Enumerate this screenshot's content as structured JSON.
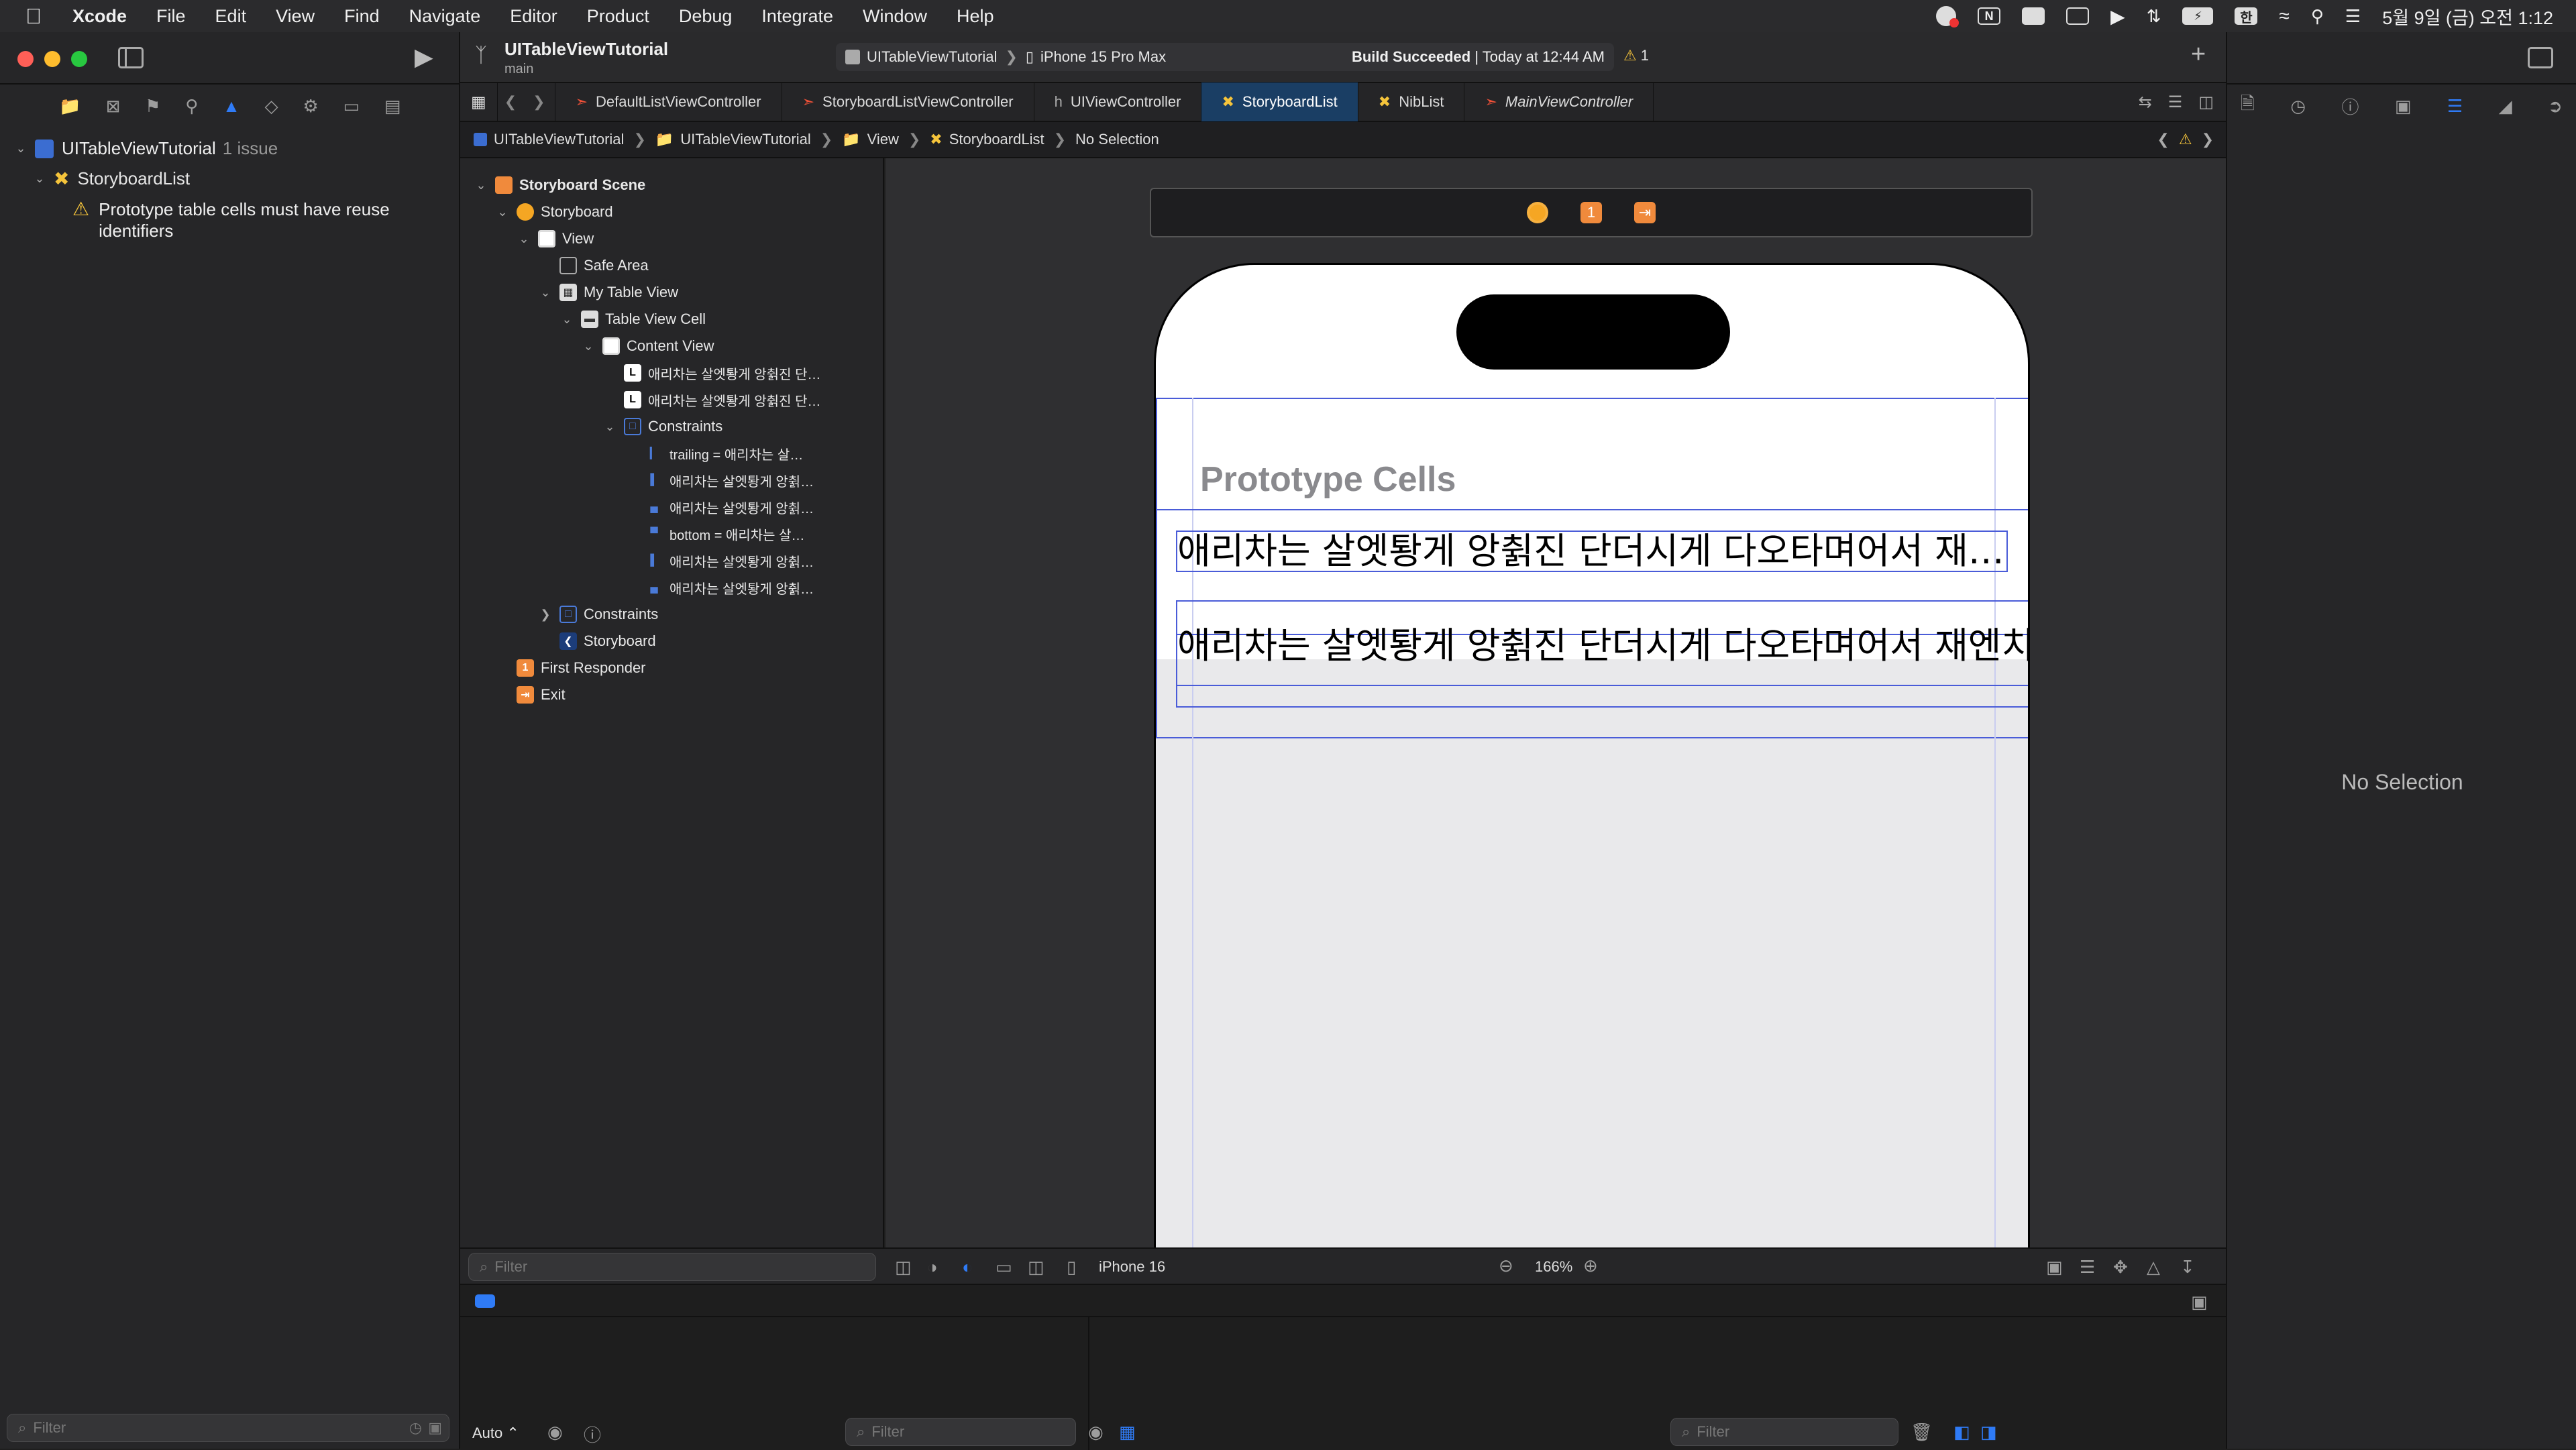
{
  "menubar": {
    "items": [
      "Xcode",
      "File",
      "Edit",
      "View",
      "Find",
      "Navigate",
      "Editor",
      "Product",
      "Debug",
      "Integrate",
      "Window",
      "Help"
    ],
    "ime": "한",
    "notion_badge": "N",
    "datetime": "5월 9일 (금) 오전 1:12"
  },
  "navigator": {
    "project_name": "UITableViewTutorial",
    "issue_count": "1 issue",
    "file_name": "StoryboardList",
    "issue_text": "Prototype table cells must have reuse identifiers",
    "filter_placeholder": "Filter"
  },
  "toolbar": {
    "project": "UITableViewTutorial",
    "branch": "main",
    "scheme": "UITableViewTutorial",
    "device": "iPhone 15 Pro Max",
    "status_bold": "Build Succeeded",
    "status_rest": " | Today at 12:44 AM",
    "warning_count": "1"
  },
  "tabs": [
    {
      "label": "DefaultListViewController",
      "icon": "swift-icon"
    },
    {
      "label": "StoryboardListViewController",
      "icon": "swift-icon"
    },
    {
      "label": "UIViewController",
      "icon": "header-icon"
    },
    {
      "label": "StoryboardList",
      "icon": "storyboard-icon",
      "active": true
    },
    {
      "label": "NibList",
      "icon": "xib-icon"
    },
    {
      "label": "MainViewController",
      "icon": "swift-icon",
      "italic": true
    }
  ],
  "jumpbar": [
    "UITableViewTutorial",
    "UITableViewTutorial",
    "View",
    "StoryboardList",
    "No Selection"
  ],
  "outline": [
    {
      "label": "Storyboard Scene",
      "bold": true
    },
    {
      "label": "Storyboard"
    },
    {
      "label": "View"
    },
    {
      "label": "Safe Area"
    },
    {
      "label": "My Table View"
    },
    {
      "label": "Table View Cell"
    },
    {
      "label": "Content View"
    },
    {
      "label": "애리차는 살엣퇑게 앙췱진 단…"
    },
    {
      "label": "애리차는 살엣퇑게 앙췱진 단…"
    },
    {
      "label": "Constraints"
    },
    {
      "label": "trailing = 애리차는 살…"
    },
    {
      "label": "애리차는 살엣퇑게 앙췱…"
    },
    {
      "label": "애리차는 살엣퇑게 앙췱…"
    },
    {
      "label": "bottom = 애리차는 살…"
    },
    {
      "label": "애리차는 살엣퇑게 앙췱…"
    },
    {
      "label": "애리차는 살엣퇑게 앙췱…"
    },
    {
      "label": "Constraints"
    },
    {
      "label": "Storyboard"
    },
    {
      "label": "First Responder"
    },
    {
      "label": "Exit"
    }
  ],
  "outline_filter_placeholder": "Filter",
  "canvas": {
    "scene_badge": "1",
    "section_header": "Prototype Cells",
    "cell1_text": "애리차는 살엣퇑게 앙췱진 단더시게 다오타며어서 재…",
    "cell2_text": "애리차는 살엣퇑게 앙췱진 단더시게 다오타며어서 재엔치어",
    "device_label": "iPhone 16",
    "zoom": "166%"
  },
  "inspector": {
    "empty_text": "No Selection"
  },
  "debug": {
    "auto_label": "Auto ⌃",
    "filter_left": "Filter",
    "filter_right": "Filter"
  },
  "colors": {
    "accent": "#2f7bf6",
    "warning": "#f5c43b",
    "storyboard_orange": "#f08a3c",
    "constraint_blue": "#4a5cd8",
    "active_tab": "#1a3e64"
  }
}
